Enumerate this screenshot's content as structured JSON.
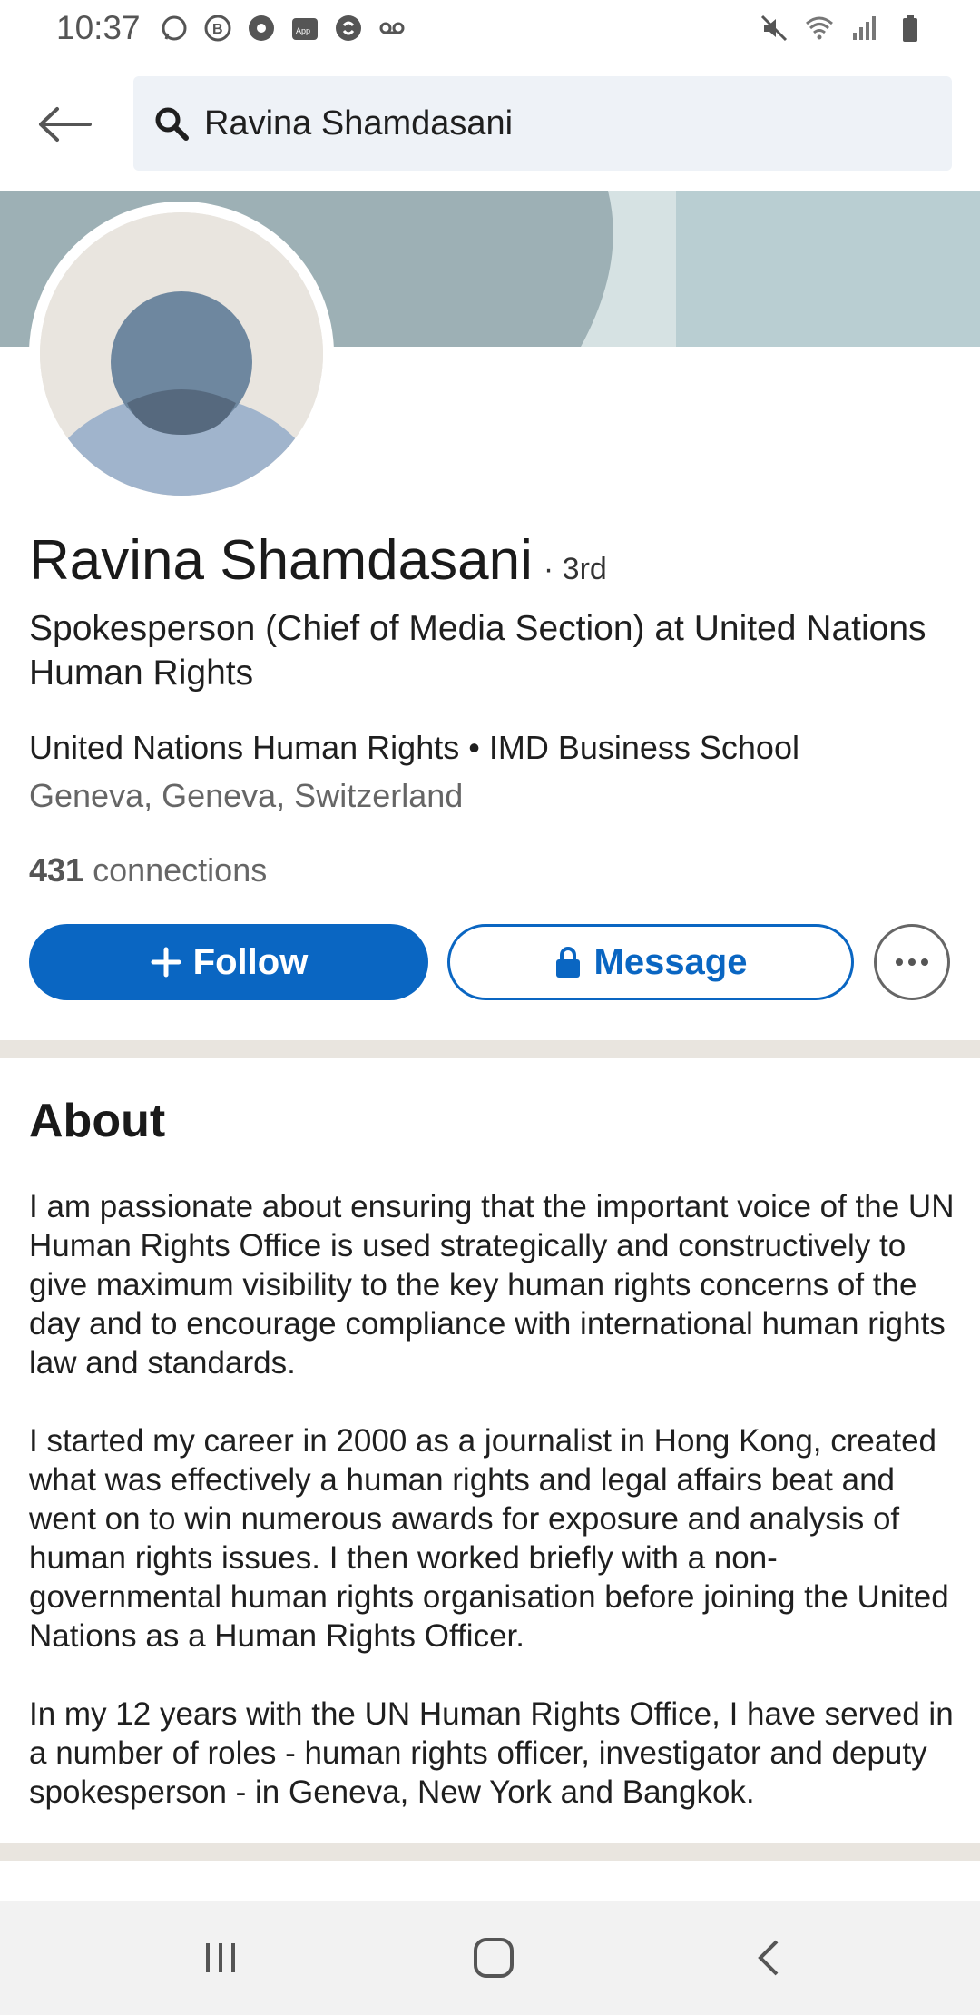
{
  "status_bar": {
    "time": "10:37",
    "left_icons": [
      "whatsapp-icon",
      "b-app-icon",
      "chrome-icon",
      "app-icon",
      "shazam-icon",
      "voicemail-icon"
    ],
    "right_icons": [
      "mute-icon",
      "wifi-icon",
      "signal-icon",
      "battery-icon"
    ]
  },
  "search": {
    "query": "Ravina Shamdasani"
  },
  "profile": {
    "name": "Ravina Shamdasani",
    "degree": "· 3rd",
    "headline": "Spokesperson (Chief of Media Section) at United Nations Human Rights",
    "orgs": "United Nations Human Rights • IMD Business School",
    "location": "Geneva, Geneva, Switzerland",
    "connections_count": "431",
    "connections_label": "connections"
  },
  "actions": {
    "follow_label": "Follow",
    "message_label": "Message"
  },
  "about": {
    "title": "About",
    "paragraphs": [
      "I am passionate about ensuring that the important voice of the UN Human Rights Office is used strategically and constructively to give maximum visibility to the key human rights concerns of the day and to encourage compliance with international human rights law and standards.",
      "I started my career in 2000 as a journalist in Hong Kong, created what was effectively a human rights and legal affairs beat and went on to win numerous awards for exposure and analysis of human rights issues. I then worked briefly with a non-governmental human rights organisation before joining the United Nations as a Human Rights Officer.",
      "In my 12 years with the UN Human Rights Office, I have served in a number of roles - human rights officer, investigator and deputy spokesperson - in Geneva, New York and Bangkok."
    ]
  },
  "colors": {
    "accent": "#0a66c2",
    "banner": "#9db0b5",
    "divider": "#e9e5df"
  }
}
